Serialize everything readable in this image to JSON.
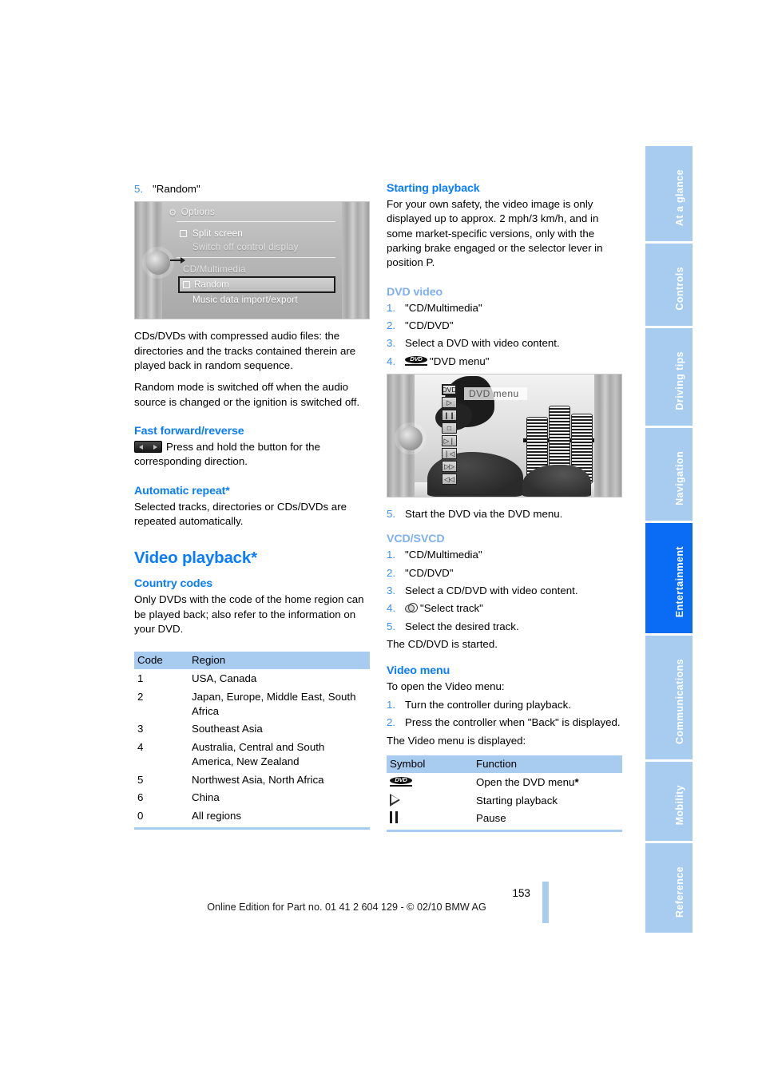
{
  "sidebar": {
    "tabs": [
      {
        "label": "At a glance",
        "active": false
      },
      {
        "label": "Controls",
        "active": false
      },
      {
        "label": "Driving tips",
        "active": false
      },
      {
        "label": "Navigation",
        "active": false
      },
      {
        "label": "Entertainment",
        "active": true
      },
      {
        "label": "Communications",
        "active": false
      },
      {
        "label": "Mobility",
        "active": false
      },
      {
        "label": "Reference",
        "active": false
      }
    ]
  },
  "left_column": {
    "step5": {
      "number": "5.",
      "text": "\"Random\""
    },
    "options_screen": {
      "title": "Options",
      "items": [
        "Split screen",
        "Switch off control display",
        "CD/Multimedia",
        "Random",
        "Music data import/export"
      ],
      "selected": "Random"
    },
    "paragraph_1": "CDs/DVDs with compressed audio files: the directories and the tracks contained therein are played back in random sequence.",
    "paragraph_2": "Random mode is switched off when the audio source is changed or the ignition is switched off.",
    "fast_forward": {
      "heading": "Fast forward/reverse",
      "text": "Press and hold the button for the corresponding direction."
    },
    "automatic_repeat": {
      "heading": "Automatic repeat*",
      "text": "Selected tracks, directories or CDs/DVDs are repeated automatically."
    },
    "video_playback_heading": "Video playback*",
    "country_codes": {
      "heading": "Country codes",
      "intro": "Only DVDs with the code of the home region can be played back; also refer to the information on your DVD.",
      "columns": [
        "Code",
        "Region"
      ],
      "rows": [
        {
          "code": "1",
          "region": "USA, Canada"
        },
        {
          "code": "2",
          "region": "Japan, Europe, Middle East, South Africa"
        },
        {
          "code": "3",
          "region": "Southeast Asia"
        },
        {
          "code": "4",
          "region": "Australia, Central and South America, New Zealand"
        },
        {
          "code": "5",
          "region": "Northwest Asia, North Africa"
        },
        {
          "code": "6",
          "region": "China"
        },
        {
          "code": "0",
          "region": "All regions"
        }
      ]
    }
  },
  "right_column": {
    "starting_playback": {
      "heading": "Starting playback",
      "text": "For your own safety, the video image is only displayed up to approx. 2 mph/3 km/h, and in some market-specific versions, only with the parking brake engaged or the selector lever in position P."
    },
    "dvd_video": {
      "heading": "DVD video",
      "steps": [
        {
          "number": "1.",
          "text": "\"CD/Multimedia\""
        },
        {
          "number": "2.",
          "text": "\"CD/DVD\""
        },
        {
          "number": "3.",
          "text": "Select a DVD with video content."
        },
        {
          "number": "4.",
          "text": "\"DVD menu\"",
          "icon": "dvd-logo-icon"
        }
      ],
      "step5": {
        "number": "5.",
        "text": "Start the DVD via the DVD menu."
      }
    },
    "dvd_screen": {
      "label": "DVD menu",
      "buttons": [
        "dvd-menu-icon",
        "play-icon",
        "pause-icon",
        "stop-icon",
        "next-track-icon",
        "previous-track-icon",
        "fast-forward-icon",
        "rewind-icon"
      ]
    },
    "vcd_svcd": {
      "heading": "VCD/SVCD",
      "steps": [
        {
          "number": "1.",
          "text": "\"CD/Multimedia\""
        },
        {
          "number": "2.",
          "text": "\"CD/DVD\""
        },
        {
          "number": "3.",
          "text": "Select a CD/DVD with video content."
        },
        {
          "number": "4.",
          "text": "\"Select track\"",
          "icon": "disc-icon"
        },
        {
          "number": "5.",
          "text": "Select the desired track."
        }
      ],
      "closing": "The CD/DVD is started."
    },
    "video_menu": {
      "heading": "Video menu",
      "intro": "To open the Video menu:",
      "steps": [
        {
          "number": "1.",
          "text": "Turn the controller during playback."
        },
        {
          "number": "2.",
          "text": "Press the controller when \"Back\" is displayed."
        }
      ],
      "closing": "The Video menu is displayed:",
      "table": {
        "columns": [
          "Symbol",
          "Function"
        ],
        "rows": [
          {
            "symbol": "dvd-logo-icon",
            "function": "Open the DVD menu",
            "star": "*"
          },
          {
            "symbol": "play-icon",
            "function": "Starting playback",
            "star": ""
          },
          {
            "symbol": "pause-icon",
            "function": "Pause",
            "star": ""
          }
        ]
      }
    }
  },
  "footer": {
    "page_number": "153",
    "text": "Online Edition for Part no. 01 41 2 604 129 - © 02/10 BMW AG"
  },
  "colors": {
    "heading_blue": "#0a7cff",
    "subheading_light_blue": "#7fb0f2",
    "tab_blue": "#a8cbf0",
    "tab_active_blue": "#0a6cf5",
    "table_header_blue": "#a8cbf0"
  }
}
